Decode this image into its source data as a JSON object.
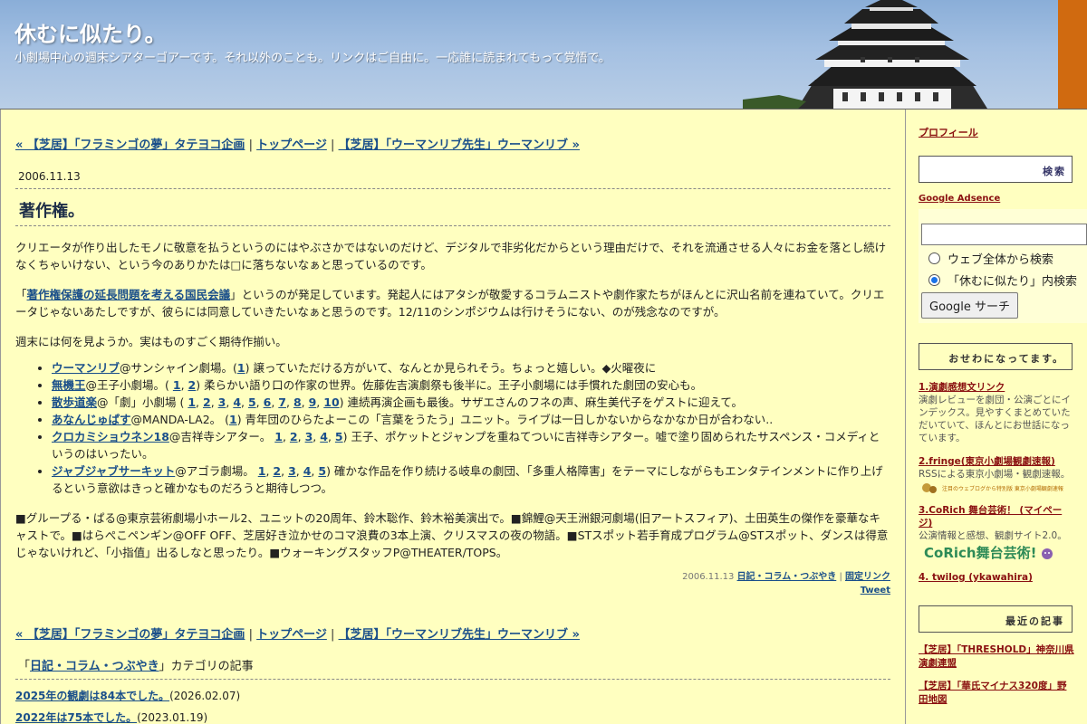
{
  "banner": {
    "title": "休むに似たり。",
    "description": "小劇場中心の週末シアターゴアーです。それ以外のことも。リンクはご自由に。一応誰に読まれてもって覚悟で。"
  },
  "nav": {
    "prev": "« 【芝居】「フラミンゴの夢」タテヨコ企画",
    "top": "トップページ",
    "next": "【芝居】「ウーマンリブ先生」ウーマンリブ »",
    "sep": "|"
  },
  "post": {
    "date": "2006.11.13",
    "title": "著作権。",
    "p1": "クリエータが作り出したモノに敬意を払うというのにはやぶさかではないのだけど、デジタルで非劣化だからという理由だけで、それを流通させる人々にお金を落とし続けなくちゃいけない、という今のありかたは□に落ちないなぁと思っているのです。",
    "p2_open": "「",
    "p2_link": "著作権保護の延長問題を考える国民会議",
    "p2_rest": "」というのが発足しています。発起人にはアタシが敬愛するコラムニストや劇作家たちがほんとに沢山名前を連ねていて。クリエータじゃないあたしですが、彼らには同意していきたいなぁと思うのです。12/11のシンポジウムは行けそうにない、のが残念なのですが。",
    "p3": "週末には何を見ようか。実はものすごく期待作揃い。",
    "items": [
      {
        "name": "ウーマンリブ",
        "a": "@サンシャイン劇場。(",
        "nums": [
          "1"
        ],
        "b": ") 譲っていただける方がいて、なんとか見られそう。ちょっと嬉しい。◆火曜夜に"
      },
      {
        "name": "無機王",
        "a": "@王子小劇場。( ",
        "nums": [
          "1",
          "2"
        ],
        "b": ") 柔らかい語り口の作家の世界。佐藤佐吉演劇祭も後半に。王子小劇場には手慣れた劇団の安心も。"
      },
      {
        "name": "散歩道楽",
        "a": "@「劇」小劇場 ( ",
        "nums": [
          "1",
          "2",
          "3",
          "4",
          "5",
          "6",
          "7",
          "8",
          "9",
          "10"
        ],
        "b": ") 連続再演企画も最後。サザエさんのフネの声、麻生美代子をゲストに迎えて。"
      },
      {
        "name": "あなんじゅぱす",
        "a": "@MANDA-LA2。 (",
        "nums": [
          "1"
        ],
        "b": ") 青年団のひらたよーこの「言葉をうたう」ユニット。ライブは一日しかないからなかなか日が合わない.."
      },
      {
        "name": "クロカミショウネン18",
        "a": "@吉祥寺シアター。 ",
        "nums": [
          "1",
          "2",
          "3",
          "4",
          "5"
        ],
        "b": ") 王子、ポケットとジャンプを重ねてついに吉祥寺シアター。嘘で塗り固められたサスペンス・コメディというのはいったい。"
      },
      {
        "name": "ジャブジャブサーキット",
        "a": "@アゴラ劇場。 ",
        "nums": [
          "1",
          "2",
          "3",
          "4",
          "5"
        ],
        "b": ") 確かな作品を作り続ける岐阜の劇団、「多重人格障害」をテーマにしながらもエンタテインメントに作り上げるという意欲はきっと確かなものだろうと期待しつつ。"
      }
    ],
    "p4": "■グループる・ぱる@東京芸術劇場小ホール2、ユニットの20周年、鈴木聡作、鈴木裕美演出で。■錦鯉@天王洲銀河劇場(旧アートスフィア)、土田英生の傑作を豪華なキャストで。■はらぺこペンギン@OFF OFF、芝居好き泣かせのコマ浪費の3本上演、クリスマスの夜の物語。■STスポット若手育成プログラム@STスポット、ダンスは得意じゃないけれど、「小指值」出るしなと思ったり。■ウォーキングスタッフP@THEATER/TOPS。",
    "meta_date": "2006.11.13",
    "meta_cat": "日記・コラム・つぶやき",
    "meta_perma": "固定リンク",
    "meta_tweet": "Tweet"
  },
  "category": {
    "open": "「",
    "name": "日記・コラム・つぶやき",
    "close": "」カテゴリの記事",
    "entries": [
      {
        "title": "2025年の観劇は84本でした。",
        "date": "(2026.02.07)"
      },
      {
        "title": "2022年は75本でした。",
        "date": "(2023.01.19)"
      }
    ]
  },
  "sidebar": {
    "profile": "プロフィール",
    "search_head": "検索",
    "adsense": "Google Adsence",
    "radio_web": "ウェブ全体から検索",
    "radio_site": "「休むに似たり」内検索",
    "google_btn": "Google サーチ",
    "osewa_head": "おせわになってます。",
    "links": [
      {
        "title": "1.演劇感想文リンク",
        "desc": "演劇レビューを劇団・公演ごとにインデックス。見やすくまとめていただいていて、ほんとにお世話になっています。"
      },
      {
        "title": "2.fringe(東京小劇場観劇速報)",
        "desc": "RSSによる東京小劇場・観劇速報。"
      },
      {
        "title": "3.CoRich 舞台芸術！ (マイページ)",
        "desc": "公演情報と感想、観劇サイト2.0。"
      },
      {
        "title": "4. twilog (ykawahira)",
        "desc": ""
      }
    ],
    "fringe_logo": "注目のウェブログから特別版 東京小劇場観劇速報",
    "corich_logo": "CoRich舞台芸術!",
    "recent_head": "最近の記事",
    "recent": [
      "【芝居】「THRESHOLD」神奈川県演劇連盟",
      "【芝居】「華氏マイナス320度」野田地図"
    ]
  }
}
